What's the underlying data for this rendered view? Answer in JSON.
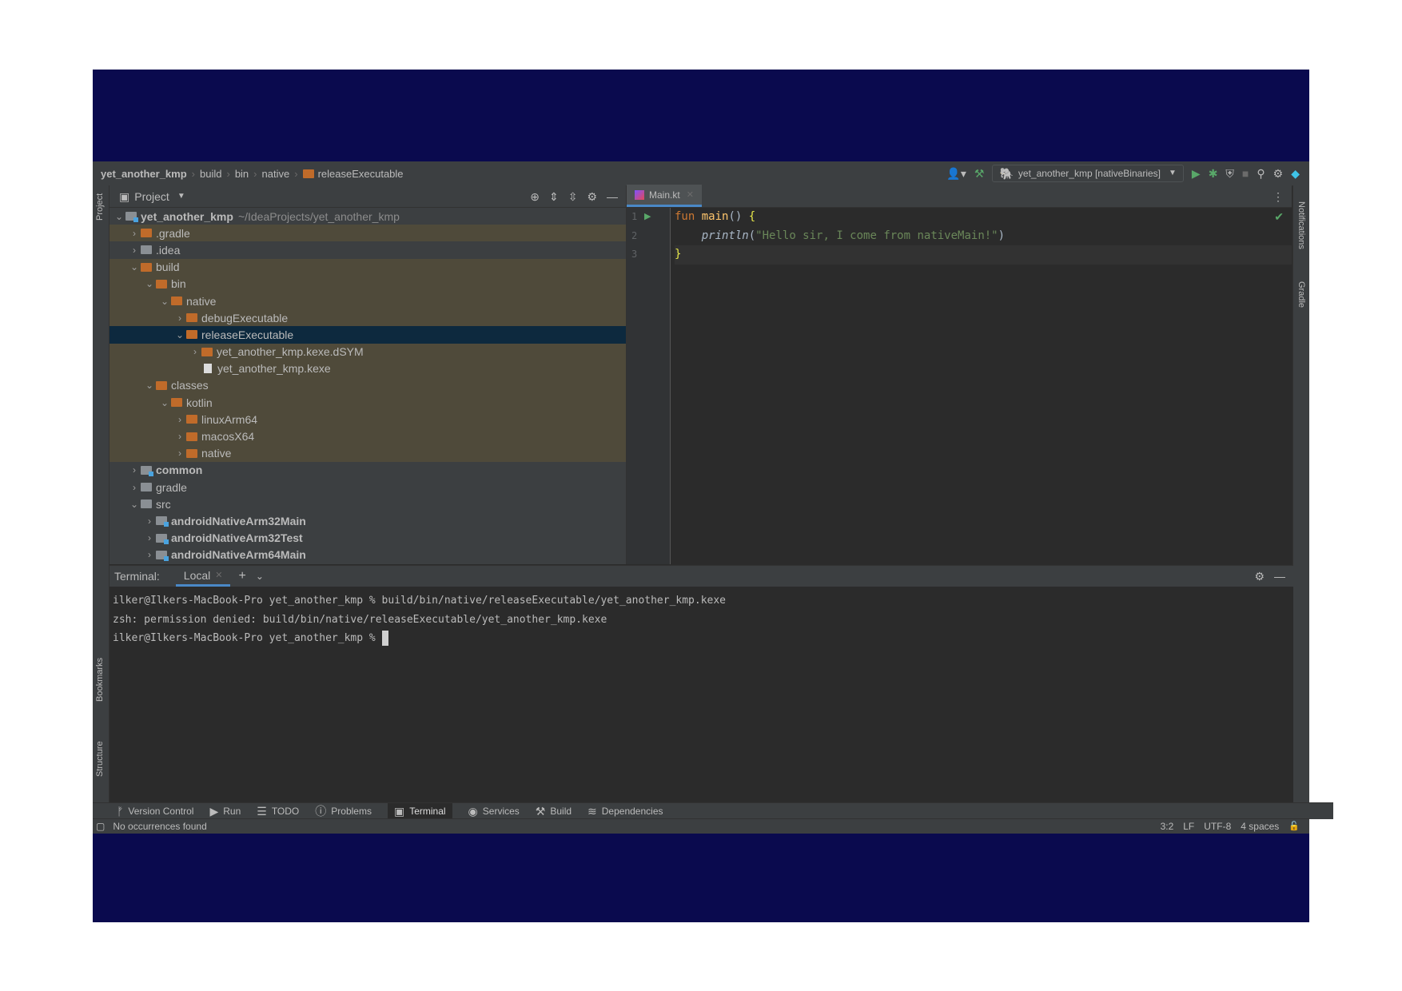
{
  "breadcrumb": [
    "yet_another_kmp",
    "build",
    "bin",
    "native",
    "releaseExecutable"
  ],
  "run_config": "yet_another_kmp [nativeBinaries]",
  "left_strip": {
    "project": "Project",
    "bookmarks": "Bookmarks",
    "structure": "Structure"
  },
  "right_strip": {
    "notifications": "Notifications",
    "gradle": "Gradle"
  },
  "project_panel": {
    "title": "Project",
    "tree": [
      {
        "label": "yet_another_kmp",
        "path": "~/IdeaProjects/yet_another_kmp"
      },
      {
        "label": ".gradle"
      },
      {
        "label": ".idea"
      },
      {
        "label": "build"
      },
      {
        "label": "bin"
      },
      {
        "label": "native"
      },
      {
        "label": "debugExecutable"
      },
      {
        "label": "releaseExecutable"
      },
      {
        "label": "yet_another_kmp.kexe.dSYM"
      },
      {
        "label": "yet_another_kmp.kexe"
      },
      {
        "label": "classes"
      },
      {
        "label": "kotlin"
      },
      {
        "label": "linuxArm64"
      },
      {
        "label": "macosX64"
      },
      {
        "label": "native"
      },
      {
        "label": "common"
      },
      {
        "label": "gradle"
      },
      {
        "label": "src"
      },
      {
        "label": "androidNativeArm32Main"
      },
      {
        "label": "androidNativeArm32Test"
      },
      {
        "label": "androidNativeArm64Main"
      }
    ]
  },
  "editor": {
    "tab": "Main.kt",
    "line_numbers": [
      "1",
      "2",
      "3"
    ],
    "code": {
      "kw_fun": "fun",
      "fn_main": "main",
      "parens": "() ",
      "open_brace": "{",
      "println": "println",
      "paren_open": "(",
      "string": "\"Hello sir, I come from nativeMain!\"",
      "paren_close": ")",
      "close_brace": "}"
    }
  },
  "terminal": {
    "title": "Terminal:",
    "tab": "Local",
    "lines": [
      "ilker@Ilkers-MacBook-Pro yet_another_kmp % build/bin/native/releaseExecutable/yet_another_kmp.kexe",
      "zsh: permission denied: build/bin/native/releaseExecutable/yet_another_kmp.kexe",
      "ilker@Ilkers-MacBook-Pro yet_another_kmp % "
    ]
  },
  "bottom_tools": [
    "Version Control",
    "Run",
    "TODO",
    "Problems",
    "Terminal",
    "Services",
    "Build",
    "Dependencies"
  ],
  "status": {
    "message": "No occurrences found",
    "position": "3:2",
    "line_sep": "LF",
    "encoding": "UTF-8",
    "indent": "4 spaces"
  }
}
